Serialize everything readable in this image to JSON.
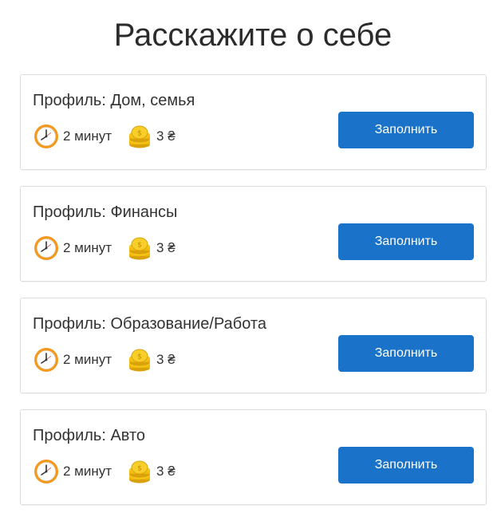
{
  "page": {
    "title": "Расскажите о себе"
  },
  "cards": [
    {
      "title": "Профиль: Дом, семья",
      "time": "2 минут",
      "reward": "3 ₴",
      "button": "Заполнить"
    },
    {
      "title": "Профиль: Финансы",
      "time": "2 минут",
      "reward": "3 ₴",
      "button": "Заполнить"
    },
    {
      "title": "Профиль: Образование/Работа",
      "time": "2 минут",
      "reward": "3 ₴",
      "button": "Заполнить"
    },
    {
      "title": "Профиль: Авто",
      "time": "2 минут",
      "reward": "3 ₴",
      "button": "Заполнить"
    }
  ],
  "icons": {
    "time": "clock-icon",
    "reward": "coins-icon"
  },
  "colors": {
    "button": "#1a73c8",
    "clock_ring": "#f39a1e",
    "coin": "#f5c518"
  }
}
